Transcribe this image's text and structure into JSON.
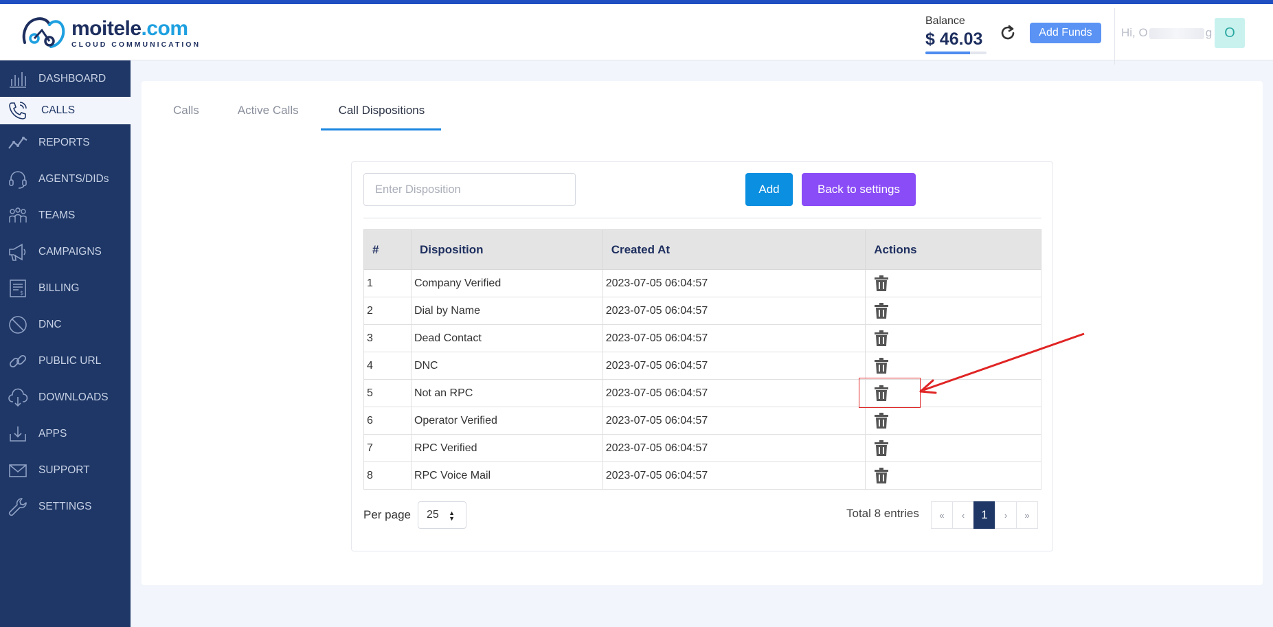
{
  "header": {
    "brand_name": "moitele",
    "brand_tld": ".com",
    "brand_tagline": "CLOUD COMMUNICATION",
    "balance_label": "Balance",
    "balance_value": "$ 46.03",
    "add_funds_label": "Add Funds",
    "greeting_prefix": "Hi, O",
    "greeting_suffix": "g",
    "avatar_initial": "O",
    "accent_color": "#1f4fc1"
  },
  "sidebar": {
    "items": [
      {
        "label": "DASHBOARD",
        "icon": "dashboard-icon"
      },
      {
        "label": "CALLS",
        "icon": "phone-icon"
      },
      {
        "label": "REPORTS",
        "icon": "reports-icon"
      },
      {
        "label": "AGENTS/DIDs",
        "icon": "headset-icon"
      },
      {
        "label": "TEAMS",
        "icon": "teams-icon"
      },
      {
        "label": "CAMPAIGNS",
        "icon": "megaphone-icon"
      },
      {
        "label": "BILLING",
        "icon": "billing-icon"
      },
      {
        "label": "DNC",
        "icon": "block-icon"
      },
      {
        "label": "PUBLIC URL",
        "icon": "link-icon"
      },
      {
        "label": "DOWNLOADS",
        "icon": "cloud-download-icon"
      },
      {
        "label": "APPS",
        "icon": "apps-download-icon"
      },
      {
        "label": "SUPPORT",
        "icon": "mail-icon"
      },
      {
        "label": "SETTINGS",
        "icon": "wrench-icon"
      }
    ],
    "active": "CALLS"
  },
  "tabs": [
    {
      "label": "Calls"
    },
    {
      "label": "Active Calls"
    },
    {
      "label": "Call Dispositions"
    }
  ],
  "form": {
    "placeholder": "Enter Disposition",
    "add_label": "Add",
    "back_label": "Back to settings"
  },
  "table": {
    "headers": [
      "#",
      "Disposition",
      "Created At",
      "Actions"
    ],
    "rows": [
      {
        "num": "1",
        "disposition": "Company Verified",
        "created": "2023-07-05 06:04:57"
      },
      {
        "num": "2",
        "disposition": "Dial by Name",
        "created": "2023-07-05 06:04:57"
      },
      {
        "num": "3",
        "disposition": "Dead Contact",
        "created": "2023-07-05 06:04:57"
      },
      {
        "num": "4",
        "disposition": "DNC",
        "created": "2023-07-05 06:04:57"
      },
      {
        "num": "5",
        "disposition": "Not an RPC",
        "created": "2023-07-05 06:04:57"
      },
      {
        "num": "6",
        "disposition": "Operator Verified",
        "created": "2023-07-05 06:04:57"
      },
      {
        "num": "7",
        "disposition": "RPC Verified",
        "created": "2023-07-05 06:04:57"
      },
      {
        "num": "8",
        "disposition": "RPC Voice Mail",
        "created": "2023-07-05 06:04:57"
      }
    ]
  },
  "footer": {
    "per_page_label": "Per page",
    "per_page_value": "25",
    "total_label": "Total 8 entries",
    "pager": {
      "first": "«",
      "prev": "‹",
      "current": "1",
      "next": "›",
      "last": "»"
    }
  }
}
